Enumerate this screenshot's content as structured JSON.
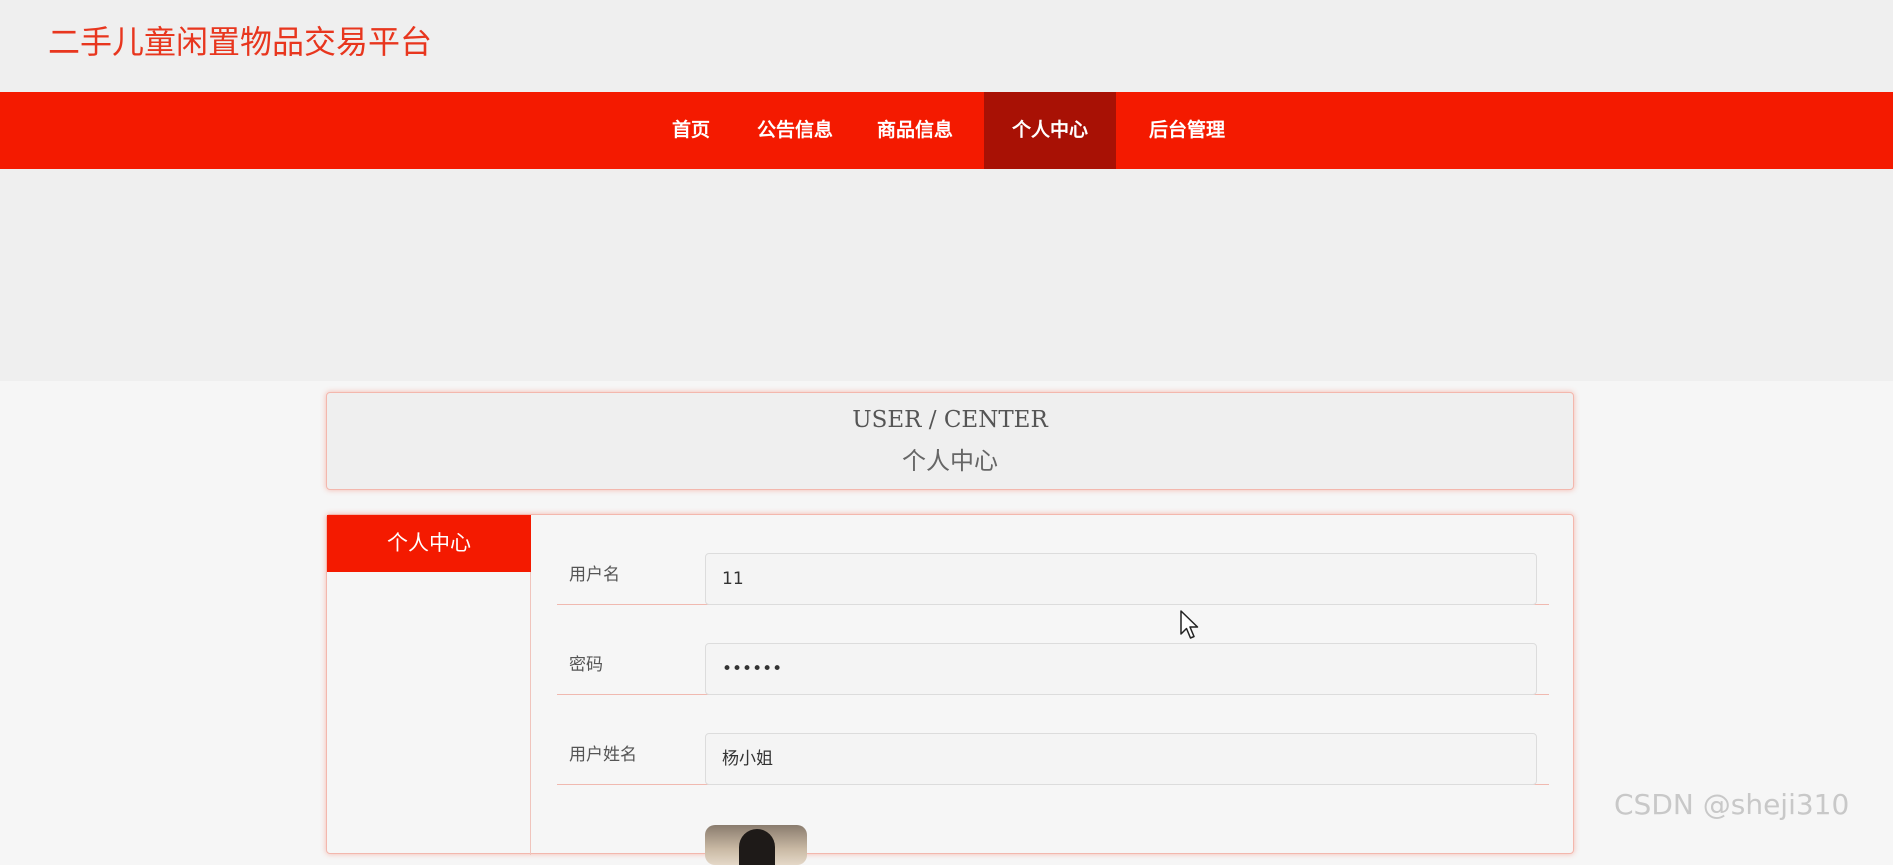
{
  "site": {
    "title": "二手儿童闲置物品交易平台"
  },
  "nav": {
    "items": [
      {
        "label": "首页"
      },
      {
        "label": "公告信息"
      },
      {
        "label": "商品信息"
      },
      {
        "label": "个人中心"
      },
      {
        "label": "后台管理"
      }
    ],
    "active": "个人中心"
  },
  "page_title": {
    "en": "USER / CENTER",
    "cn": "个人中心"
  },
  "sidebar": {
    "heading": "个人中心"
  },
  "form": {
    "fields": [
      {
        "label": "用户名",
        "value": "11"
      },
      {
        "label": "密码",
        "value": "••••••"
      },
      {
        "label": "用户姓名",
        "value": "杨小姐"
      }
    ]
  },
  "watermark": "CSDN @sheji310",
  "colors": {
    "brand_red": "#f41a00",
    "active_nav": "#a81105",
    "title_red": "#e8361e"
  }
}
